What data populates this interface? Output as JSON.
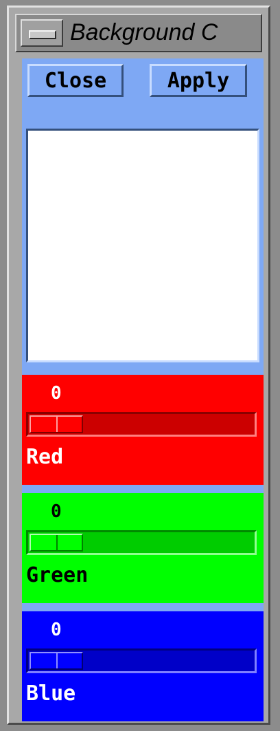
{
  "window": {
    "title": "Background C",
    "menu_icon": "window-menu-icon"
  },
  "toolbar": {
    "close_label": "Close",
    "apply_label": "Apply"
  },
  "colors": {
    "client_background": "#7ea8f4",
    "preview": "#ffffff",
    "red": "#ff0000",
    "green": "#00ff00",
    "blue": "#0000ff"
  },
  "sliders": {
    "red": {
      "label": "Red",
      "value": "0"
    },
    "green": {
      "label": "Green",
      "value": "0"
    },
    "blue": {
      "label": "Blue",
      "value": "0"
    }
  }
}
